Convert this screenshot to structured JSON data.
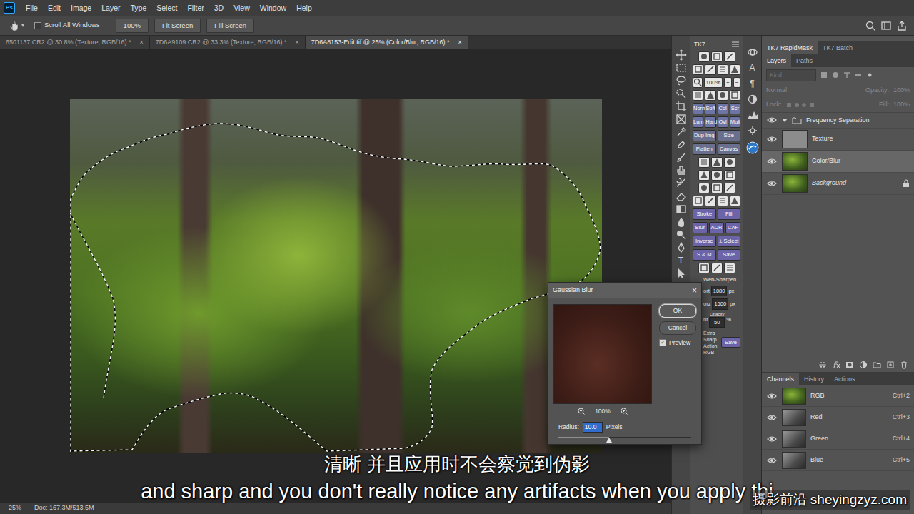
{
  "app": {
    "logo": "Ps"
  },
  "menu": [
    "File",
    "Edit",
    "Image",
    "Layer",
    "Type",
    "Select",
    "Filter",
    "3D",
    "View",
    "Window",
    "Help"
  ],
  "options_bar": {
    "tool_arrow": "▾",
    "scroll_all": {
      "label": "Scroll All Windows",
      "checked": false
    },
    "buttons": [
      "100%",
      "Fit Screen",
      "Fill Screen"
    ]
  },
  "doc_tabs": [
    {
      "label": "6501137.CR2 @ 30.8% (Texture, RGB/16) *",
      "close": "×",
      "selected": false
    },
    {
      "label": "7D6A9109.CR2 @ 33.3% (Texture, RGB/16) *",
      "close": "×",
      "selected": false
    },
    {
      "label": "7D6A8153-Edit.tif @ 25% (Color/Blur, RGB/16) *",
      "close": "×",
      "selected": true
    }
  ],
  "canvas": {
    "selection_active": true
  },
  "status_bar": {
    "zoom": "25%",
    "doc": "Doc: 167.3M/513.5M"
  },
  "toolbar_glyphs": [
    "T"
  ],
  "tk7": {
    "title": "TK7",
    "rows": [
      {
        "kind": "icons",
        "count": 3
      },
      {
        "kind": "icons",
        "count": 4
      },
      {
        "kind": "zoom",
        "items": [
          "100%",
          "+",
          "−"
        ]
      },
      {
        "kind": "icons",
        "count": 4
      },
      {
        "kind": "labels",
        "color": "#6d74a6",
        "items": [
          "Norm",
          "Soft",
          "Col",
          "Scr"
        ]
      },
      {
        "kind": "labels",
        "color": "#6d74a6",
        "items": [
          "Lum",
          "Hard",
          "Ovl",
          "Mult"
        ]
      },
      {
        "kind": "labels",
        "color": "#6a6f8e",
        "items": [
          "Dup Img",
          "Size"
        ]
      },
      {
        "kind": "labels",
        "color": "#6a6f8e",
        "items": [
          "Flatten",
          "Canvas"
        ]
      },
      {
        "kind": "icons",
        "count": 3
      },
      {
        "kind": "icons",
        "count": 3
      },
      {
        "kind": "icons",
        "count": 3
      },
      {
        "kind": "icons",
        "count": 4
      },
      {
        "kind": "labels",
        "color": "#6c64a8",
        "items": [
          "Stroke",
          "Fill"
        ]
      },
      {
        "kind": "labels",
        "color": "#6c64a8",
        "items": [
          "Blur",
          "ACR",
          "CAF"
        ]
      },
      {
        "kind": "labels",
        "color": "#6c64a8",
        "items": [
          "Inverse",
          "± Select"
        ]
      },
      {
        "kind": "labels",
        "color": "#6c64a8",
        "items": [
          "S & M",
          "Save"
        ]
      },
      {
        "kind": "icons",
        "count": 3
      }
    ],
    "web": {
      "title": "Web-Sharpen",
      "fields": [
        {
          "label": "ort",
          "value": "1080",
          "unit": "px"
        },
        {
          "label": "orz",
          "value": "1500",
          "unit": "px"
        },
        {
          "label": "nt",
          "caption": "Opacity",
          "value": "50",
          "unit": "%"
        }
      ],
      "action": [
        "Extra Sharp",
        "Action",
        "RGB"
      ],
      "save": "Save"
    }
  },
  "side_glyphs": [
    "A",
    "¶"
  ],
  "right_panel": {
    "tabs": [
      {
        "label": "TK7 RapidMask",
        "selected": true
      },
      {
        "label": "TK7 Batch",
        "selected": false
      }
    ],
    "layers_tabs": [
      {
        "label": "Layers",
        "selected": true
      },
      {
        "label": "Paths",
        "selected": false
      }
    ],
    "filter": {
      "placeholder": "Kind"
    },
    "blend": {
      "mode": "Normal",
      "opacity_label": "Opacity:",
      "opacity": "100%",
      "disabled": true
    },
    "lock": {
      "label": "Lock:",
      "fill_label": "Fill:",
      "fill": "100%",
      "disabled": true
    },
    "layers": [
      {
        "name": "Frequency Separation",
        "kind": "group",
        "expanded": true,
        "visible": true,
        "selected": false,
        "locked": false
      },
      {
        "name": "Texture",
        "kind": "layer",
        "thumb": "gray",
        "visible": true,
        "selected": false,
        "locked": false
      },
      {
        "name": "Color/Blur",
        "kind": "layer",
        "thumb": "photo",
        "visible": true,
        "selected": true,
        "locked": false
      },
      {
        "name": "Background",
        "kind": "background",
        "thumb": "photo",
        "visible": true,
        "selected": false,
        "locked": true
      }
    ],
    "channels_tabs": [
      {
        "label": "Channels",
        "selected": true
      },
      {
        "label": "History",
        "selected": false
      },
      {
        "label": "Actions",
        "selected": false
      }
    ],
    "channels": [
      {
        "name": "RGB",
        "shortcut": "Ctrl+2",
        "thumb": "photo",
        "visible": true
      },
      {
        "name": "Red",
        "shortcut": "Ctrl+3",
        "thumb": "gray",
        "visible": true
      },
      {
        "name": "Green",
        "shortcut": "Ctrl+4",
        "thumb": "gray",
        "visible": true
      },
      {
        "name": "Blue",
        "shortcut": "Ctrl+5",
        "thumb": "gray",
        "visible": true
      }
    ]
  },
  "dialog": {
    "title": "Gaussian Blur",
    "close": "×",
    "zoom": "100%",
    "buttons": [
      {
        "label": "OK",
        "selected": true
      },
      {
        "label": "Cancel",
        "selected": false
      }
    ],
    "preview": {
      "label": "Preview",
      "checked": true
    },
    "radius": {
      "label": "Radius:",
      "value": "10.0",
      "unit": "Pixels",
      "level": 0.38
    }
  },
  "subtitles": {
    "zh": "清晰 并且应用时不会察觉到伪影",
    "en": "and sharp and you don't really notice any artifacts when you apply thi"
  },
  "watermark": "摄影前沿 sheyingzyz.com"
}
